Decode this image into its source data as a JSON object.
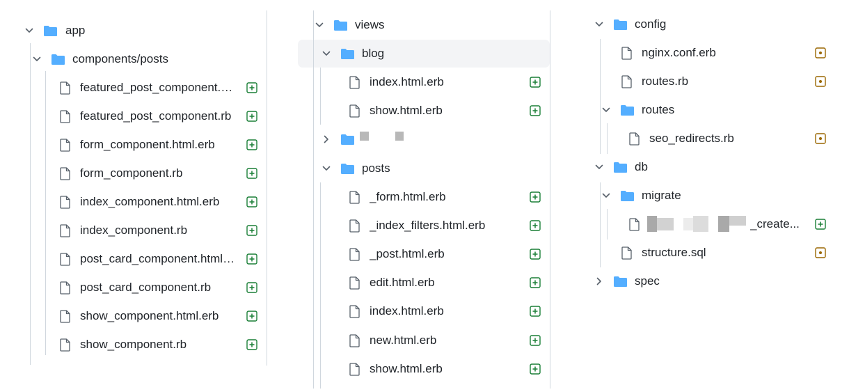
{
  "colors": {
    "folder": "#54aeff",
    "added": "#1a7f37",
    "modified": "#9a6700",
    "selected_bg": "#f3f4f6"
  },
  "icons": {
    "expanded": "chevron-down-icon",
    "collapsed": "chevron-right-icon",
    "folder": "folder-icon",
    "file": "file-icon",
    "added": "diff-added-icon",
    "modified": "diff-modified-icon"
  },
  "col1": {
    "app": "app",
    "components_posts": "components/posts",
    "files": [
      "featured_post_component.html.erb",
      "featured_post_component.rb",
      "form_component.html.erb",
      "form_component.rb",
      "index_component.html.erb",
      "index_component.rb",
      "post_card_component.html.erb",
      "post_card_component.rb",
      "show_component.html.erb",
      "show_component.rb"
    ]
  },
  "col2": {
    "views": "views",
    "blog": "blog",
    "blog_files": [
      "index.html.erb",
      "show.html.erb"
    ],
    "posts": "posts",
    "posts_files": [
      "_form.html.erb",
      "_index_filters.html.erb",
      "_post.html.erb",
      "edit.html.erb",
      "index.html.erb",
      "new.html.erb",
      "show.html.erb"
    ]
  },
  "col3": {
    "config": "config",
    "config_files": [
      "nginx.conf.erb",
      "routes.rb"
    ],
    "routes": "routes",
    "routes_files": [
      "seo_redirects.rb"
    ],
    "db": "db",
    "migrate": "migrate",
    "migrate_file_suffix": "_create...",
    "structure": "structure.sql",
    "spec": "spec"
  }
}
